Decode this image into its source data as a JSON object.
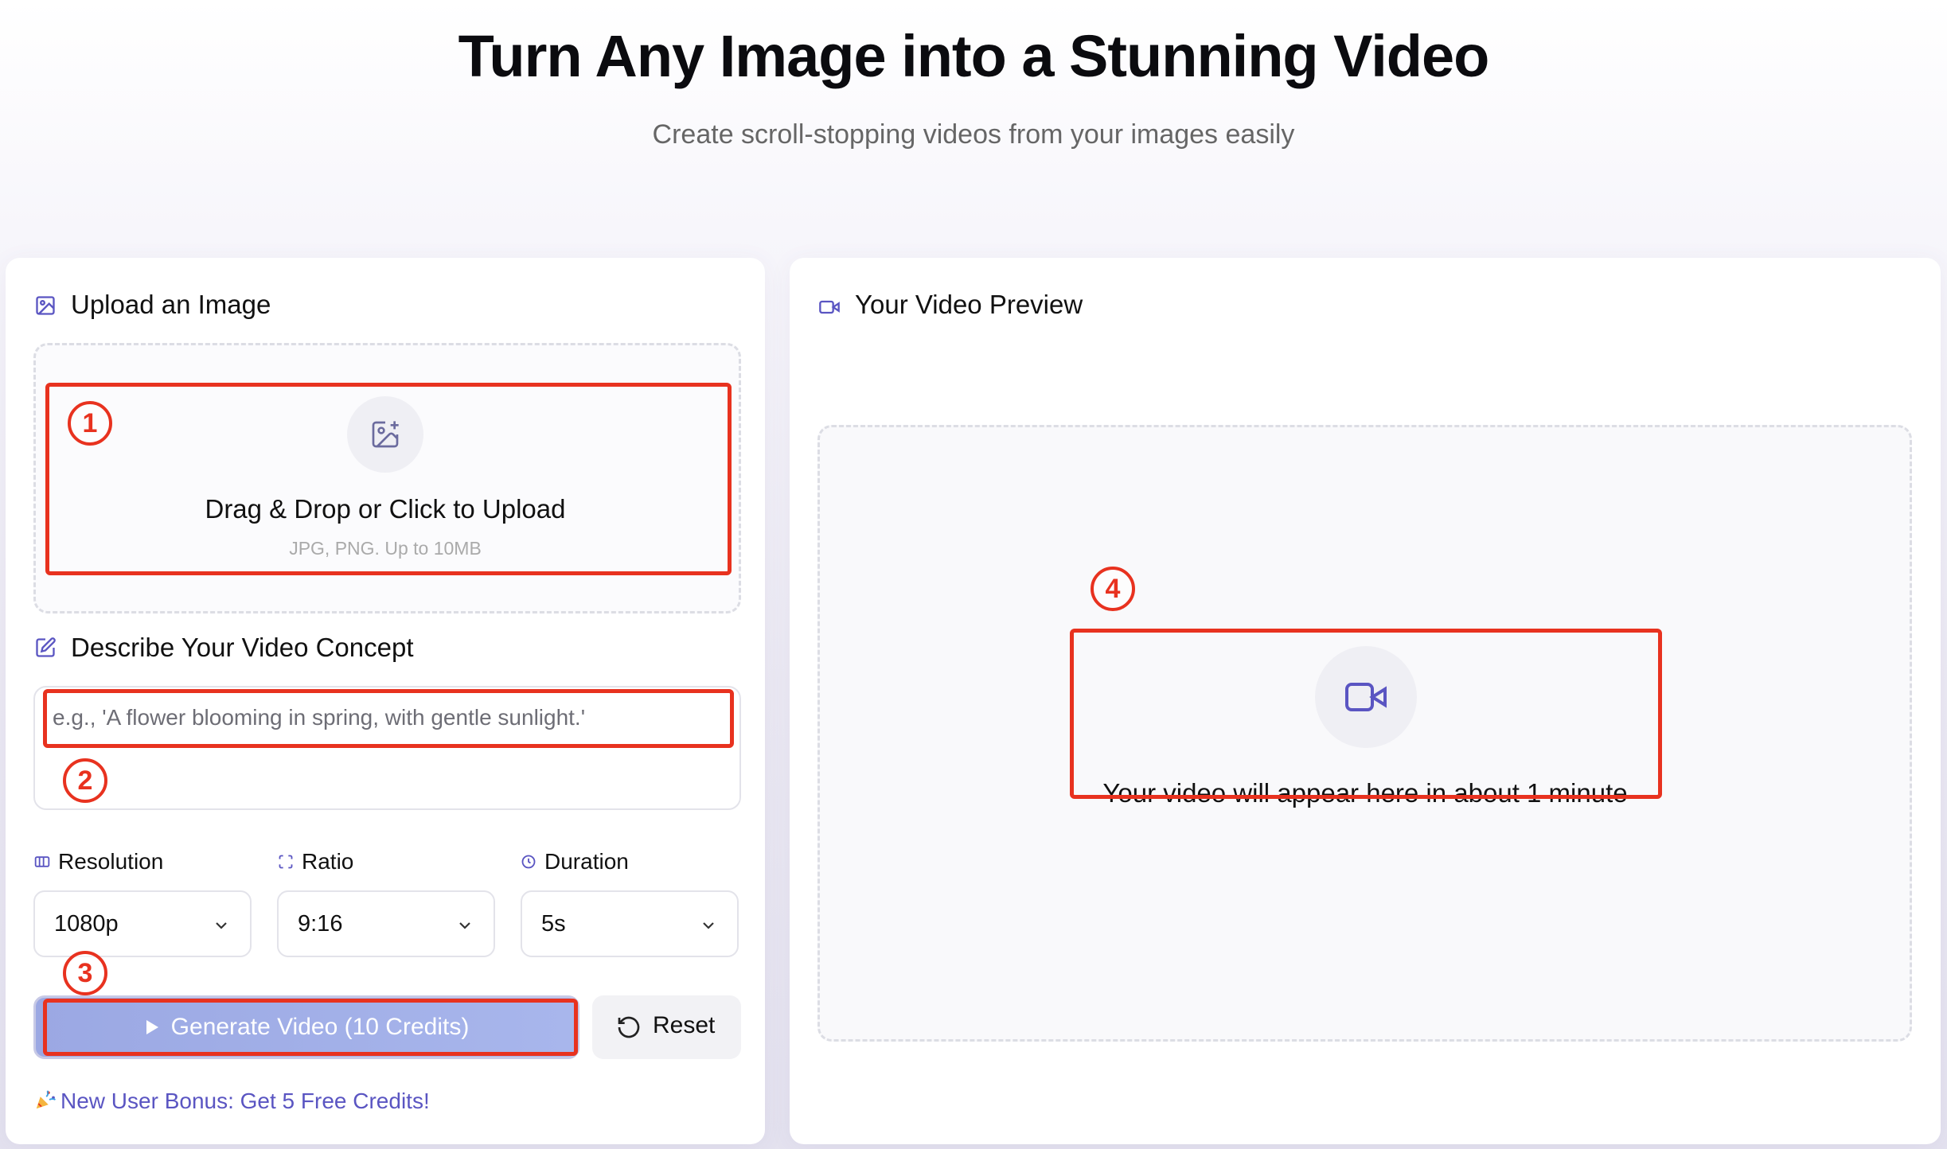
{
  "hero": {
    "title": "Turn Any Image into a Stunning Video",
    "subtitle": "Create scroll-stopping videos from your images easily"
  },
  "upload": {
    "section_title": "Upload an Image",
    "dropzone_main": "Drag & Drop or Click to Upload",
    "dropzone_sub": "JPG, PNG. Up to 10MB"
  },
  "concept": {
    "section_title": "Describe Your Video Concept",
    "placeholder": "e.g., 'A flower blooming in spring, with gentle sunlight.'"
  },
  "options": {
    "resolution": {
      "label": "Resolution",
      "value": "1080p"
    },
    "ratio": {
      "label": "Ratio",
      "value": "9:16"
    },
    "duration": {
      "label": "Duration",
      "value": "5s"
    }
  },
  "actions": {
    "generate_label": "Generate Video (10 Credits)",
    "reset_label": "Reset"
  },
  "bonus_text": "New User Bonus: Get 5 Free Credits!",
  "preview": {
    "section_title": "Your Video Preview",
    "empty_text": "Your video will appear here in about 1 minute"
  },
  "annotations": [
    "1",
    "2",
    "3",
    "4"
  ],
  "colors": {
    "accent": "#5a55c2",
    "annotation": "#e8321f",
    "generate_button": "#a3b1ea"
  },
  "icons": {
    "upload_section": "image-icon",
    "dropzone": "image-plus-icon",
    "concept_section": "edit-icon",
    "resolution": "columns-icon",
    "ratio": "crop-frame-icon",
    "duration": "clock-icon",
    "generate": "play-icon",
    "reset": "rotate-ccw-icon",
    "bonus": "party-popper-icon",
    "preview_section": "video-icon",
    "preview_placeholder": "video-icon"
  }
}
